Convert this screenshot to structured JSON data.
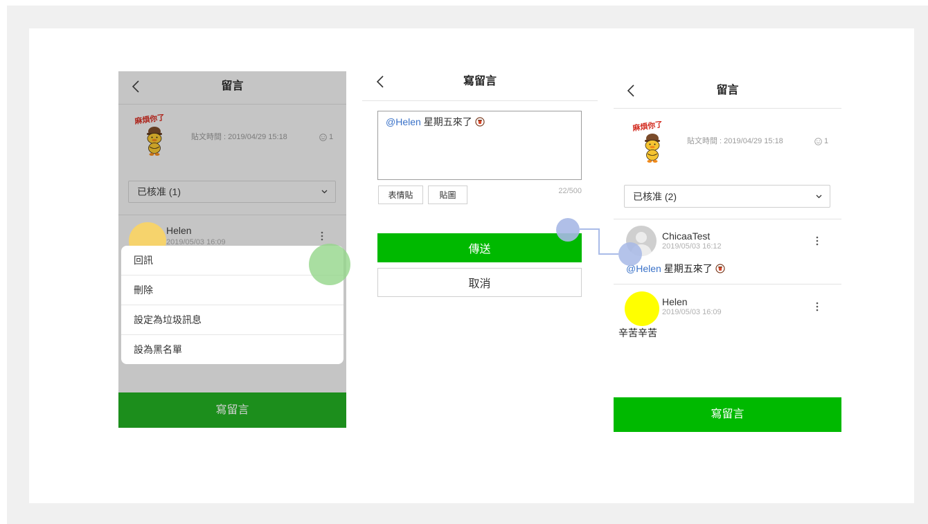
{
  "screen_list": {
    "title": "留言",
    "post": {
      "sticker_text": "麻煩你了",
      "time": "貼文時間 : 2019/04/29 15:18",
      "reaction_count": "1"
    },
    "filter_selected": "已核准 (1)",
    "comment": {
      "name": "Helen",
      "time": "2019/05/03 16:09"
    },
    "context_menu": [
      "回訊",
      "刪除",
      "設定為垃圾訊息",
      "設為黑名單"
    ],
    "footer_label": "寫留言"
  },
  "screen_compose": {
    "title": "寫留言",
    "input": {
      "mention": "@Helen",
      "text": "星期五來了"
    },
    "emoji_button": "表情貼",
    "sticker_button": "貼圖",
    "char_counter": "22/500",
    "send_label": "傳送",
    "cancel_label": "取消"
  },
  "screen_result": {
    "title": "留言",
    "post": {
      "sticker_text": "麻煩你了",
      "time": "貼文時間 : 2019/04/29 15:18",
      "reaction_count": "1"
    },
    "filter_selected": "已核准 (2)",
    "comments": [
      {
        "name": "ChicaaTest",
        "time": "2019/05/03 16:12",
        "mention": "@Helen",
        "text": "星期五來了"
      },
      {
        "name": "Helen",
        "time": "2019/05/03 16:09",
        "text": "辛苦辛苦"
      }
    ],
    "footer_label": "寫留言"
  },
  "icons": {
    "back": "chevron-left-icon",
    "reaction": "smiley-icon",
    "filter": "chevron-down-icon",
    "more": "kebab-menu-icon",
    "inline_sticker": "sticker-emoji-icon",
    "default_avatar": "user-silhouette-icon",
    "tap_indicator": "touch-point-icon"
  },
  "colors": {
    "brand_green": "#00b900",
    "mention_blue": "#3a72c8",
    "avatar_helen": "#ffff00",
    "touch_green": "#a6dba0",
    "touch_blue": "#a7b8e6"
  }
}
